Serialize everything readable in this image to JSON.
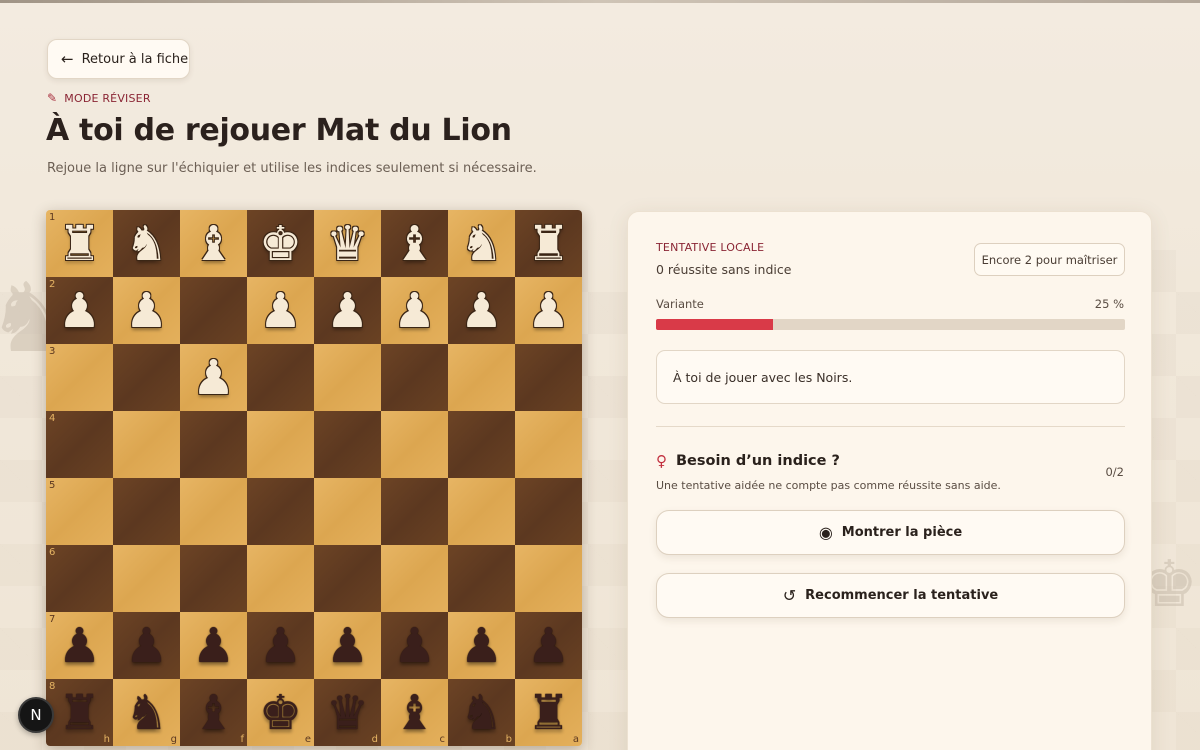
{
  "back_button": {
    "label": "Retour à la fiche",
    "icon": "arrow-left-icon"
  },
  "mode": {
    "label": "MODE RÉVISER",
    "icon": "pin-icon"
  },
  "page_title": "À toi de rejouer Mat du Lion",
  "subtitle": "Rejoue la ligne sur l'échiquier et utilise les indices seulement si nécessaire.",
  "board": {
    "ranks": [
      "1",
      "2",
      "3",
      "4",
      "5",
      "6",
      "7",
      "8"
    ],
    "files": [
      "h",
      "g",
      "f",
      "e",
      "d",
      "c",
      "b",
      "a"
    ],
    "rows": [
      [
        "wR",
        "wN",
        "wB",
        "wK",
        "wQ",
        "wB",
        "wN",
        "wR"
      ],
      [
        "wP",
        "wP",
        "",
        "wP",
        "wP",
        "wP",
        "wP",
        "wP"
      ],
      [
        "",
        "",
        "wP",
        "",
        "",
        "",
        "",
        ""
      ],
      [
        "",
        "",
        "",
        "",
        "",
        "",
        "",
        ""
      ],
      [
        "",
        "",
        "",
        "",
        "",
        "",
        "",
        ""
      ],
      [
        "",
        "",
        "",
        "",
        "",
        "",
        "",
        ""
      ],
      [
        "bP",
        "bP",
        "bP",
        "bP",
        "bP",
        "bP",
        "bP",
        "bP"
      ],
      [
        "bR",
        "bN",
        "bB",
        "bK",
        "bQ",
        "bB",
        "bN",
        "bR"
      ]
    ],
    "colors": {
      "light": "#e0ab58",
      "dark": "#633d22"
    }
  },
  "badge": {
    "label": "N"
  },
  "panel": {
    "eyebrow": "TENTATIVE LOCALE",
    "success": "0 réussite sans indice",
    "encore_button": "Encore 2 pour maîtriser",
    "variant_label": "Variante",
    "variant_percent": "25 %",
    "variant_progress": 0.25,
    "turn_message": "À toi de jouer avec les Noirs.",
    "hint_title": "Besoin d’un indice ?",
    "hint_icon": "lightbulb-icon",
    "hint_count": "0/2",
    "hint_note": "Une tentative aidée ne compte pas comme réussite sans aide.",
    "show_piece_button": "Montrer la pièce",
    "show_piece_icon": "eye-icon",
    "restart_button": "Recommencer la tentative",
    "restart_icon": "rotate-ccw-icon"
  },
  "accent_color": "#d93a48"
}
